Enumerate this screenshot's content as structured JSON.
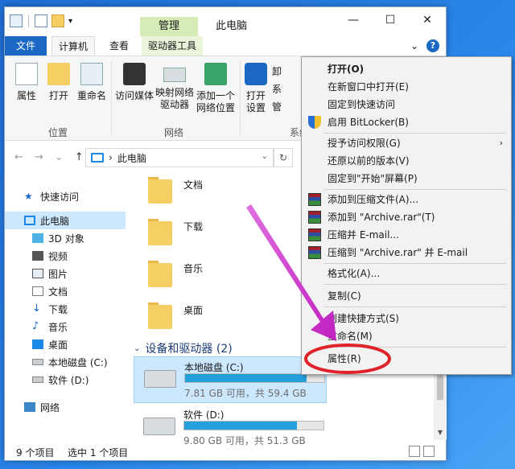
{
  "titlebar": {
    "manage_tab": "管理",
    "title": "此电脑",
    "minimize": "—",
    "maximize": "☐",
    "close": "✕"
  },
  "tabs": {
    "file": "文件",
    "computer": "计算机",
    "view": "查看",
    "drive_tools": "驱动器工具",
    "expand": "⌄",
    "help": "?"
  },
  "ribbon": {
    "properties": "属性",
    "open": "打开",
    "rename": "重命名",
    "access_media": "访问媒体",
    "map_drive_line1": "映射网络",
    "map_drive_line2": "驱动器",
    "add_location_line1": "添加一个",
    "add_location_line2": "网络位置",
    "open_settings_line1": "打开",
    "open_settings_line2": "设置",
    "partial1": "卸",
    "partial2": "系",
    "partial3": "管",
    "group_location": "位置",
    "group_network": "网络",
    "group_system": "系统"
  },
  "address": {
    "back": "←",
    "forward": "→",
    "recent": "⌄",
    "up": "↑",
    "path": "此电脑",
    "separator": "›",
    "dropdown": "⌄",
    "refresh": "↻"
  },
  "nav": {
    "items": [
      {
        "label": "快速访问",
        "selected": false
      },
      {
        "label": "此电脑",
        "selected": true
      },
      {
        "label": "3D 对象",
        "selected": false
      },
      {
        "label": "视频",
        "selected": false
      },
      {
        "label": "图片",
        "selected": false
      },
      {
        "label": "文档",
        "selected": false
      },
      {
        "label": "下载",
        "selected": false
      },
      {
        "label": "音乐",
        "selected": false
      },
      {
        "label": "桌面",
        "selected": false
      },
      {
        "label": "本地磁盘 (C:)",
        "selected": false
      },
      {
        "label": "软件 (D:)",
        "selected": false
      },
      {
        "label": "网络",
        "selected": false
      }
    ]
  },
  "content": {
    "folders": [
      "文档",
      "下载",
      "音乐",
      "桌面"
    ],
    "section_title": "设备和驱动器 (2)",
    "drives": [
      {
        "name": "本地磁盘 (C:)",
        "info": "7.81 GB 可用，共 59.4 GB",
        "used_fraction": 0.87
      },
      {
        "name": "软件 (D:)",
        "info": "9.80 GB 可用，共 51.3 GB",
        "used_fraction": 0.81
      }
    ]
  },
  "status": {
    "count": "9 个项目",
    "selected": "选中 1 个项目"
  },
  "context_menu": {
    "open": "打开(O)",
    "open_new_window": "在新窗口中打开(E)",
    "pin_quick_access": "固定到快速访问",
    "bitlocker": "启用 BitLocker(B)",
    "grant_access": "授予访问权限(G)",
    "restore_versions": "还原以前的版本(V)",
    "pin_start": "固定到\"开始\"屏幕(P)",
    "add_archive": "添加到压缩文件(A)...",
    "add_rar": "添加到 \"Archive.rar\"(T)",
    "compress_email": "压缩并 E-mail...",
    "compress_rar_email": "压缩到 \"Archive.rar\" 并 E-mail",
    "format": "格式化(A)...",
    "copy": "复制(C)",
    "create_shortcut": "创建快捷方式(S)",
    "rename": "重命名(M)",
    "properties": "属性(R)",
    "submenu_arrow": "›"
  },
  "colors": {
    "accent": "#1b68c4",
    "selection": "#cce8ff",
    "drive_bar": "#26a0da",
    "annotation": "#c832c8",
    "highlight_ring": "#e0232a"
  }
}
